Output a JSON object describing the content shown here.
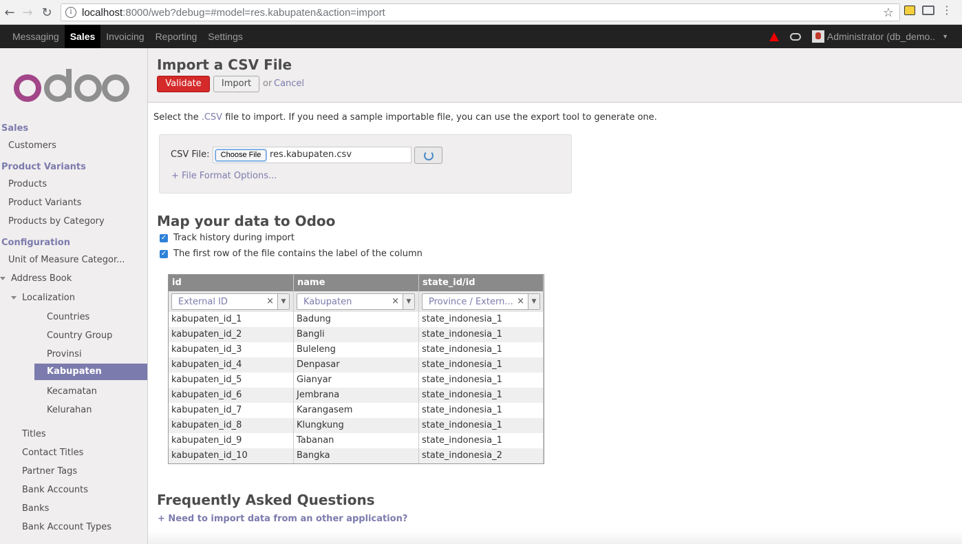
{
  "browser": {
    "url_host": "localhost",
    "url_path": ":8000/web?debug=#model=res.kabupaten&action=import"
  },
  "topmenu": {
    "items": [
      "Messaging",
      "Sales",
      "Invoicing",
      "Reporting",
      "Settings"
    ],
    "active": "Sales",
    "user": "Administrator (db_demo.."
  },
  "sidebar": {
    "sections": {
      "sales": "Sales",
      "product_variants": "Product Variants",
      "configuration": "Configuration"
    },
    "items": {
      "customers": "Customers",
      "products": "Products",
      "product_variants": "Product Variants",
      "products_by_category": "Products by Category",
      "uom_categories": "Unit of Measure Categor...",
      "address_book": "Address Book",
      "localization": "Localization",
      "countries": "Countries",
      "country_group": "Country Group",
      "provinsi": "Provinsi",
      "kabupaten": "Kabupaten",
      "kecamatan": "Kecamatan",
      "kelurahan": "Kelurahan",
      "titles": "Titles",
      "contact_titles": "Contact Titles",
      "partner_tags": "Partner Tags",
      "bank_accounts": "Bank Accounts",
      "banks": "Banks",
      "bank_account_types": "Bank Account Types"
    }
  },
  "header": {
    "title": "Import a CSV File",
    "validate": "Validate",
    "import": "Import",
    "or": "or",
    "cancel": "Cancel"
  },
  "intro": {
    "before": "Select the ",
    "csv": ".CSV",
    "after": " file to import. If you need a sample importable file, you can use the export tool to generate one."
  },
  "file": {
    "label": "CSV File:",
    "choose": "Choose File",
    "filename": "res.kabupaten.csv",
    "format_options": "+ File Format Options..."
  },
  "map": {
    "title": "Map your data to Odoo",
    "track_history": "Track history during import",
    "first_row": "The first row of the file contains the label of the column"
  },
  "grid": {
    "headers": [
      "id",
      "name",
      "state_id/id"
    ],
    "mapping": [
      "External ID",
      "Kabupaten",
      "Province / Extern..."
    ],
    "rows": [
      [
        "kabupaten_id_1",
        "Badung",
        "state_indonesia_1"
      ],
      [
        "kabupaten_id_2",
        "Bangli",
        "state_indonesia_1"
      ],
      [
        "kabupaten_id_3",
        "Buleleng",
        "state_indonesia_1"
      ],
      [
        "kabupaten_id_4",
        "Denpasar",
        "state_indonesia_1"
      ],
      [
        "kabupaten_id_5",
        "Gianyar",
        "state_indonesia_1"
      ],
      [
        "kabupaten_id_6",
        "Jembrana",
        "state_indonesia_1"
      ],
      [
        "kabupaten_id_7",
        "Karangasem",
        "state_indonesia_1"
      ],
      [
        "kabupaten_id_8",
        "Klungkung",
        "state_indonesia_1"
      ],
      [
        "kabupaten_id_9",
        "Tabanan",
        "state_indonesia_1"
      ],
      [
        "kabupaten_id_10",
        "Bangka",
        "state_indonesia_2"
      ]
    ]
  },
  "faq": {
    "title": "Frequently Asked Questions",
    "q1": "+ Need to import data from an other application?"
  }
}
